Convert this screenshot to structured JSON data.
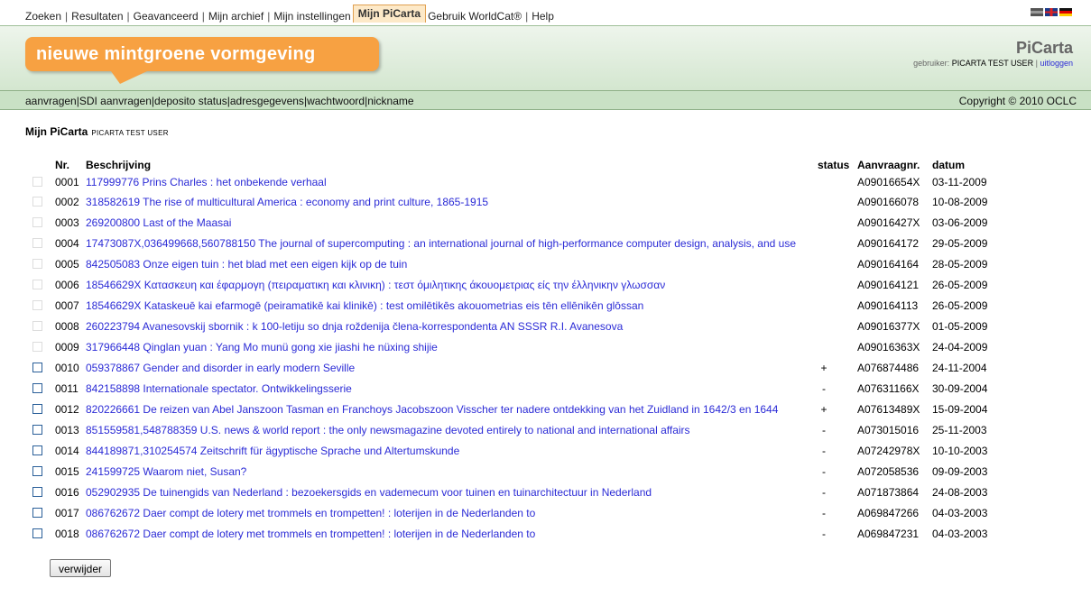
{
  "topnav": {
    "items": [
      "Zoeken",
      "Resultaten",
      "Geavanceerd",
      "Mijn archief",
      "Mijn instellingen"
    ],
    "active": "Mijn PiCarta",
    "after": [
      "Gebruik WorldCat®",
      "Help"
    ]
  },
  "banner": {
    "text": "nieuwe mintgroene vormgeving"
  },
  "brand": {
    "name": "PiCarta",
    "user_label": "gebruiker:",
    "user_name": "PICARTA TEST USER",
    "logout": "uitloggen"
  },
  "subnav": {
    "items": [
      "aanvragen",
      "SDI aanvragen",
      "deposito status",
      "adresgegevens",
      "wachtwoord",
      "nickname"
    ],
    "copyright": "Copyright © 2010 OCLC"
  },
  "page": {
    "title": "Mijn PiCarta",
    "subtitle": "PICARTA TEST USER"
  },
  "table": {
    "headers": {
      "nr": "Nr.",
      "desc": "Beschrijving",
      "status": "status",
      "aanvraagnr": "Aanvraagnr.",
      "datum": "datum"
    },
    "rows": [
      {
        "nr": "0001",
        "desc": "117999776 Prins Charles : het onbekende verhaal",
        "status": "",
        "aanvraagnr": "A09016654X",
        "datum": "03-11-2009",
        "checkbox": false
      },
      {
        "nr": "0002",
        "desc": "318582619 The rise of multicultural America : economy and print culture, 1865-1915",
        "status": "",
        "aanvraagnr": "A090166078",
        "datum": "10-08-2009",
        "checkbox": false
      },
      {
        "nr": "0003",
        "desc": "269200800 Last of the Maasai",
        "status": "",
        "aanvraagnr": "A09016427X",
        "datum": "03-06-2009",
        "checkbox": false
      },
      {
        "nr": "0004",
        "desc": "17473087X,036499668,560788150 The journal of supercomputing : an international journal of high-performance computer design, analysis, and use",
        "status": "",
        "aanvraagnr": "A090164172",
        "datum": "29-05-2009",
        "checkbox": false
      },
      {
        "nr": "0005",
        "desc": "842505083 Onze eigen tuin : het blad met een eigen kijk op de tuin",
        "status": "",
        "aanvraagnr": "A090164164",
        "datum": "28-05-2009",
        "checkbox": false
      },
      {
        "nr": "0006",
        "desc": "18546629X Κατασκευη και έφαρμογη (πειραματικη και κλινικη) : τεστ όμιλητικης άκουομετριας είς την έλληνικην γλωσσαν",
        "status": "",
        "aanvraagnr": "A090164121",
        "datum": "26-05-2009",
        "checkbox": false
      },
      {
        "nr": "0007",
        "desc": "18546629X Kataskeuē kai efarmogē (peiramatikē kai klinikē) : test omilētikēs akouometrias eis tēn ellēnikēn glōssan",
        "status": "",
        "aanvraagnr": "A090164113",
        "datum": "26-05-2009",
        "checkbox": false
      },
      {
        "nr": "0008",
        "desc": "260223794 Avanesovskij sbornik : k 100-letiju so dnja roždenija člena-korrespondenta AN SSSR R.I. Avanesova",
        "status": "",
        "aanvraagnr": "A09016377X",
        "datum": "01-05-2009",
        "checkbox": false
      },
      {
        "nr": "0009",
        "desc": "317966448 Qinglan yuan : Yang Mo munü gong xie jiashi he nüxing shijie",
        "status": "",
        "aanvraagnr": "A09016363X",
        "datum": "24-04-2009",
        "checkbox": false
      },
      {
        "nr": "0010",
        "desc": "059378867 Gender and disorder in early modern Seville",
        "status": "+",
        "aanvraagnr": "A076874486",
        "datum": "24-11-2004",
        "checkbox": true
      },
      {
        "nr": "0011",
        "desc": "842158898 Internationale spectator. Ontwikkelingsserie",
        "status": "-",
        "aanvraagnr": "A07631166X",
        "datum": "30-09-2004",
        "checkbox": true
      },
      {
        "nr": "0012",
        "desc": "820226661 De reizen van Abel Janszoon Tasman en Franchoys Jacobszoon Visscher ter nadere ontdekking van het Zuidland in 1642/3 en 1644",
        "status": "+",
        "aanvraagnr": "A07613489X",
        "datum": "15-09-2004",
        "checkbox": true
      },
      {
        "nr": "0013",
        "desc": "851559581,548788359 U.S. news & world report : the only newsmagazine devoted entirely to national and international affairs",
        "status": "-",
        "aanvraagnr": "A073015016",
        "datum": "25-11-2003",
        "checkbox": true
      },
      {
        "nr": "0014",
        "desc": "844189871,310254574 Zeitschrift für ägyptische Sprache und Altertumskunde",
        "status": "-",
        "aanvraagnr": "A07242978X",
        "datum": "10-10-2003",
        "checkbox": true
      },
      {
        "nr": "0015",
        "desc": "241599725 Waarom niet, Susan?",
        "status": "-",
        "aanvraagnr": "A072058536",
        "datum": "09-09-2003",
        "checkbox": true
      },
      {
        "nr": "0016",
        "desc": "052902935 De tuinengids van Nederland : bezoekersgids en vademecum voor tuinen en tuinarchitectuur in Nederland",
        "status": "-",
        "aanvraagnr": "A071873864",
        "datum": "24-08-2003",
        "checkbox": true
      },
      {
        "nr": "0017",
        "desc": "086762672 Daer compt de lotery met trommels en trompetten! : loterijen in de Nederlanden to",
        "status": "-",
        "aanvraagnr": "A069847266",
        "datum": "04-03-2003",
        "checkbox": true
      },
      {
        "nr": "0018",
        "desc": "086762672 Daer compt de lotery met trommels en trompetten! : loterijen in de Nederlanden to",
        "status": "-",
        "aanvraagnr": "A069847231",
        "datum": "04-03-2003",
        "checkbox": true
      }
    ]
  },
  "actions": {
    "delete_label": "verwijder"
  }
}
